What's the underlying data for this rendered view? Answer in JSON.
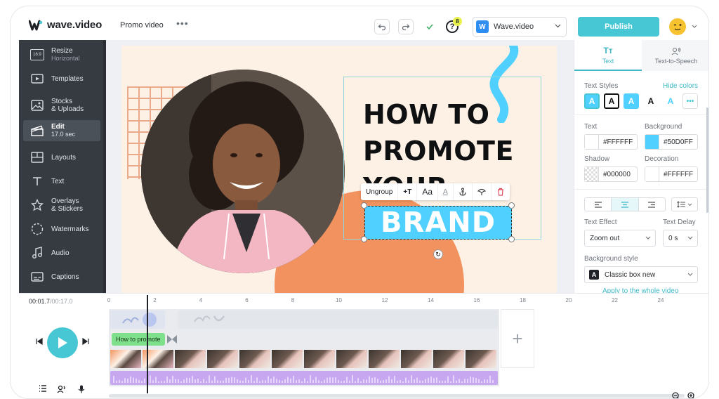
{
  "app": {
    "name": "wave.video",
    "project_title": "Promo video",
    "more_label": "•••",
    "help_badge": "8",
    "brand_initial": "W",
    "brand_name": "Wave.video",
    "publish_label": "Publish",
    "accent": "#47C7D4"
  },
  "sidebar": {
    "items": [
      {
        "icon": "aspect-ratio-icon",
        "badge": "16:9",
        "label": "Resize",
        "sub": "Horizontal"
      },
      {
        "icon": "templates-icon",
        "label": "Templates"
      },
      {
        "icon": "image-icon",
        "label": "Stocks",
        "label2": "& Uploads"
      },
      {
        "icon": "clapperboard-icon",
        "label": "Edit",
        "sub": "17.0 sec",
        "active": true
      },
      {
        "icon": "layouts-icon",
        "label": "Layouts"
      },
      {
        "icon": "text-icon",
        "label": "Text"
      },
      {
        "icon": "star-icon",
        "label": "Overlays",
        "label2": "& Stickers"
      },
      {
        "icon": "watermark-icon",
        "label": "Watermarks"
      },
      {
        "icon": "music-note-icon",
        "label": "Audio"
      },
      {
        "icon": "captions-icon",
        "label": "Captions"
      }
    ]
  },
  "canvas": {
    "headline_lines": [
      "HOW TO",
      "PROMOTE",
      "YOUR"
    ],
    "brand_word": "BRAND",
    "brand_bg": "#50D0FF",
    "toolbar": {
      "ungroup": "Ungroup",
      "add_text": "+T",
      "font": "Aa",
      "color": "A"
    }
  },
  "right_panel": {
    "tabs": [
      {
        "label": "Text",
        "icon": "text-icon"
      },
      {
        "label": "Text-to-Speech",
        "icon": "speech-icon"
      }
    ],
    "text_styles_label": "Text Styles",
    "hide_colors": "Hide colors",
    "swatch_letter": "A",
    "text_label": "Text",
    "text_value": "#FFFFFF",
    "background_label": "Background",
    "background_value": "#50D0FF",
    "shadow_label": "Shadow",
    "shadow_value": "#000000",
    "decoration_label": "Decoration",
    "decoration_value": "#FFFFFF",
    "text_effect_label": "Text Effect",
    "text_effect_value": "Zoom out",
    "text_delay_label": "Text Delay",
    "text_delay_value": "0 s",
    "bg_style_label": "Background style",
    "bg_style_icon": "A",
    "bg_style_value": "Classic box new",
    "apply_link": "Apply to the whole video"
  },
  "timeline": {
    "current_time": "00:01.7",
    "total_time": "/00:17.0",
    "ticks": [
      "0",
      "2",
      "4",
      "6",
      "8",
      "10",
      "12",
      "14",
      "16",
      "18",
      "20",
      "22",
      "24"
    ],
    "text_clip": "How to promote",
    "add_label": "+"
  }
}
